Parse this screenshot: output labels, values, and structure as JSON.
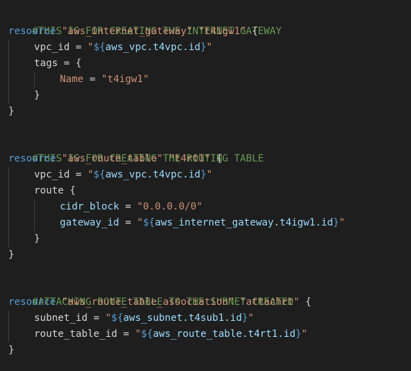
{
  "editor": {
    "blocks": [
      {
        "comment": "#THIS IS FOR CREATING THE INTERNET GATEWAY",
        "keyword": "resource",
        "type": "\"aws_internet_gateway\"",
        "name": "\"t4igw1\"",
        "vpc_key": "vpc_id",
        "vpc_open": "\"",
        "vpc_interp_open": "${",
        "vpc_ref": "aws_vpc.t4vpc.id",
        "vpc_interp_close": "}",
        "vpc_close": "\"",
        "tags_key": "tags",
        "tags_name_key": "Name",
        "tags_name_value": "\"t4igw1\""
      },
      {
        "comment": "#THIS IS FOR CREATING THE ROUTING TABLE",
        "keyword": "resource",
        "type": "\"aws_route_table\"",
        "name": "\"t4rt1\"",
        "vpc_key": "vpc_id",
        "vpc_open": "\"",
        "vpc_interp_open": "${",
        "vpc_ref": "aws_vpc.t4vpc.id",
        "vpc_interp_close": "}",
        "vpc_close": "\"",
        "route_key": "route",
        "cidr_key": "cidr_block",
        "cidr_value": "\"0.0.0.0/0\"",
        "gw_key": "gateway_id",
        "gw_open": "\"",
        "gw_interp_open": "${",
        "gw_ref": "aws_internet_gateway.t4igw1.id",
        "gw_interp_close": "}",
        "gw_close": "\""
      },
      {
        "comment": "#ATTACHING ROUTE TABLE TO THE SUBNET CREATED",
        "keyword": "resource",
        "type": "\"aws_route_table_association\"",
        "name": "\"attachrt\"",
        "subnet_key": "subnet_id",
        "subnet_open": "\"",
        "subnet_interp_open": "${",
        "subnet_ref": "aws_subnet.t4sub1.id",
        "subnet_interp_close": "}",
        "subnet_close": "\"",
        "rt_key": "route_table_id",
        "rt_open": "\"",
        "rt_interp_open": "${",
        "rt_ref": "aws_route_table.t4rt1.id",
        "rt_interp_close": "}",
        "rt_close": "\""
      }
    ],
    "punct": {
      "open_brace": "{",
      "close_brace": "}",
      "equals": " = ",
      "space": " "
    }
  },
  "colors": {
    "background": "#1e1e1e",
    "comment": "#6a9955",
    "keyword": "#569cd6",
    "string": "#ce9178",
    "variable": "#9cdcfe",
    "text": "#d4d4d4"
  }
}
